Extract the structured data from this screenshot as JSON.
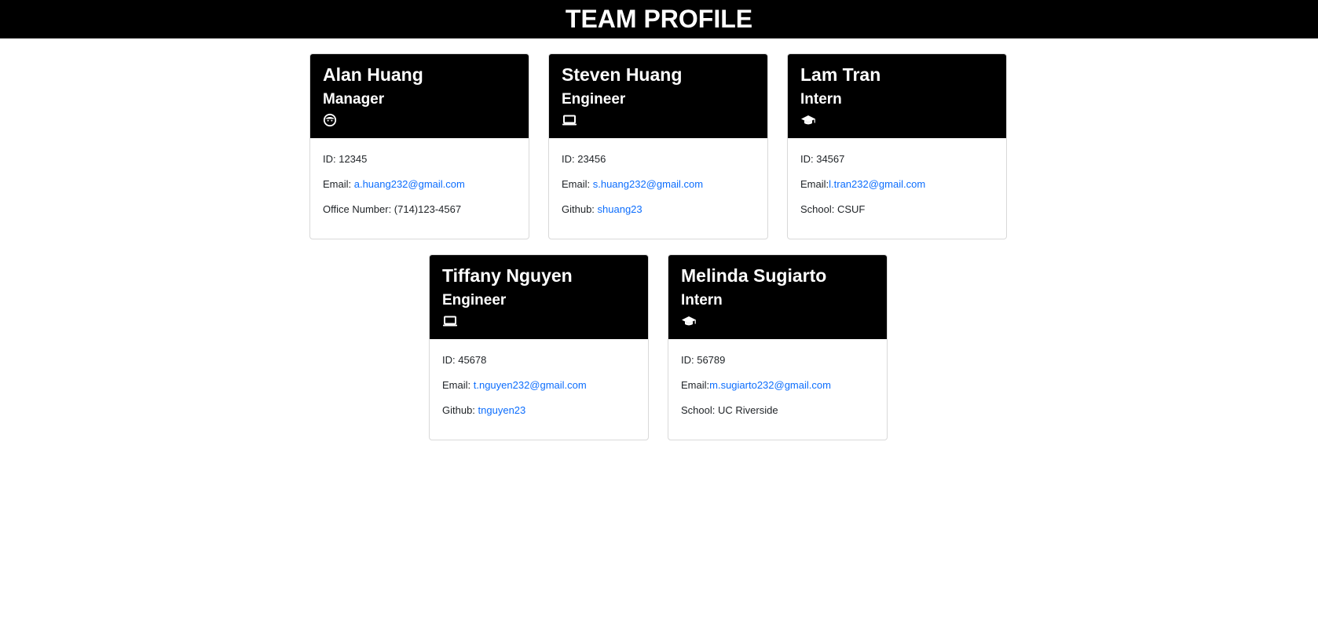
{
  "page": {
    "title": "TEAM PROFILE"
  },
  "employees": [
    {
      "name": "Alan Huang",
      "role": "Manager",
      "icon": "face-icon",
      "id_text": "ID: 12345",
      "email_label": "Email: ",
      "email": "a.huang232@gmail.com",
      "extra_label": "Office Number: (714)123-4567",
      "extra_value": ""
    },
    {
      "name": "Steven Huang",
      "role": "Engineer",
      "icon": "laptop-icon",
      "id_text": "ID: 23456",
      "email_label": "Email: ",
      "email": "s.huang232@gmail.com",
      "extra_label": "Github: ",
      "extra_value": "shuang23"
    },
    {
      "name": "Lam Tran",
      "role": "Intern",
      "icon": "graduation-cap-icon",
      "id_text": "ID: 34567",
      "email_label": "Email:",
      "email": "l.tran232@gmail.com",
      "extra_label": "School: CSUF",
      "extra_value": ""
    },
    {
      "name": "Tiffany Nguyen",
      "role": "Engineer",
      "icon": "laptop-icon",
      "id_text": "ID: 45678",
      "email_label": "Email: ",
      "email": "t.nguyen232@gmail.com",
      "extra_label": "Github: ",
      "extra_value": "tnguyen23"
    },
    {
      "name": "Melinda Sugiarto",
      "role": "Intern",
      "icon": "graduation-cap-icon",
      "id_text": "ID: 56789",
      "email_label": "Email:",
      "email": "m.sugiarto232@gmail.com",
      "extra_label": "School: UC Riverside",
      "extra_value": ""
    }
  ],
  "colors": {
    "header_bg": "#000000",
    "link": "#0d6efd",
    "card_border": "#d9d9d9"
  }
}
